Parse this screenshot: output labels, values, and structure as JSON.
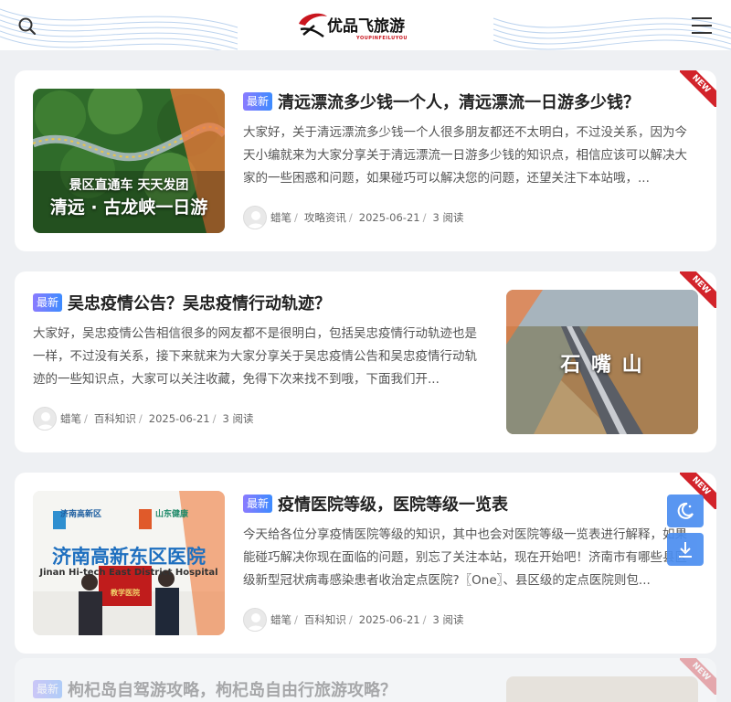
{
  "header": {
    "logo_text": "优品飞旅游",
    "logo_sub": "YOUPINFEILUYOU",
    "icons": {
      "search": "search-icon",
      "menu": "menu-icon"
    }
  },
  "ribbon_label": "NEW",
  "articles": [
    {
      "badge": "最新",
      "title": "清远漂流多少钱一个人，清远漂流一日游多少钱？",
      "excerpt": "大家好，关于清远漂流多少钱一个人很多朋友都还不太明白，不过没关系，因为今天小编就来为大家分享关于清远漂流一日游多少钱的知识点，相信应该可以解决大家的一些困惑和问题，如果碰巧可以解决您的问题，还望关注下本站哦，...",
      "author": "蜡笔",
      "category": "攻略资讯",
      "date": "2025-06-21",
      "reads": "3 阅读",
      "thumb_line1": "景区直通车 天天发团",
      "thumb_line2": "清远 · 古龙峡一日游"
    },
    {
      "badge": "最新",
      "title": "吴忠疫情公告？吴忠疫情行动轨迹？",
      "excerpt": "大家好，吴忠疫情公告相信很多的网友都不是很明白，包括吴忠疫情行动轨迹也是一样，不过没有关系，接下来就来为大家分享关于吴忠疫情公告和吴忠疫情行动轨迹的一些知识点，大家可以关注收藏，免得下次来找不到哦，下面我们开...",
      "author": "蜡笔",
      "category": "百科知识",
      "date": "2025-06-21",
      "reads": "3 阅读",
      "thumb_line1": "石 嘴 山"
    },
    {
      "badge": "最新",
      "title": "疫情医院等级，医院等级一览表",
      "excerpt": "今天给各位分享疫情医院等级的知识，其中也会对医院等级一览表进行解释，如果能碰巧解决你现在面临的问题，别忘了关注本站，现在开始吧！济南市有哪些县区级新型冠状病毒感染患者收治定点医院?〖One〗、县区级的定点医院则包...",
      "author": "蜡笔",
      "category": "百科知识",
      "date": "2025-06-21",
      "reads": "3 阅读",
      "thumb_line1": "济南高新东区医院",
      "thumb_line2": "Jinan Hi-tech East District Hospital",
      "thumb_sign1": "济南高新区",
      "thumb_sign2": "山东健康",
      "thumb_plaque": "教学医院"
    },
    {
      "badge": "最新",
      "title": "枸杞岛自驾游攻略，枸杞岛自由行旅游攻略？"
    }
  ],
  "floating": {
    "dark_mode": "moon-icon",
    "download": "download-icon"
  },
  "colors": {
    "badge_from": "#8a7bff",
    "badge_to": "#3d8bff",
    "ribbon": "#d2232a",
    "float": "#4b8ef0"
  }
}
